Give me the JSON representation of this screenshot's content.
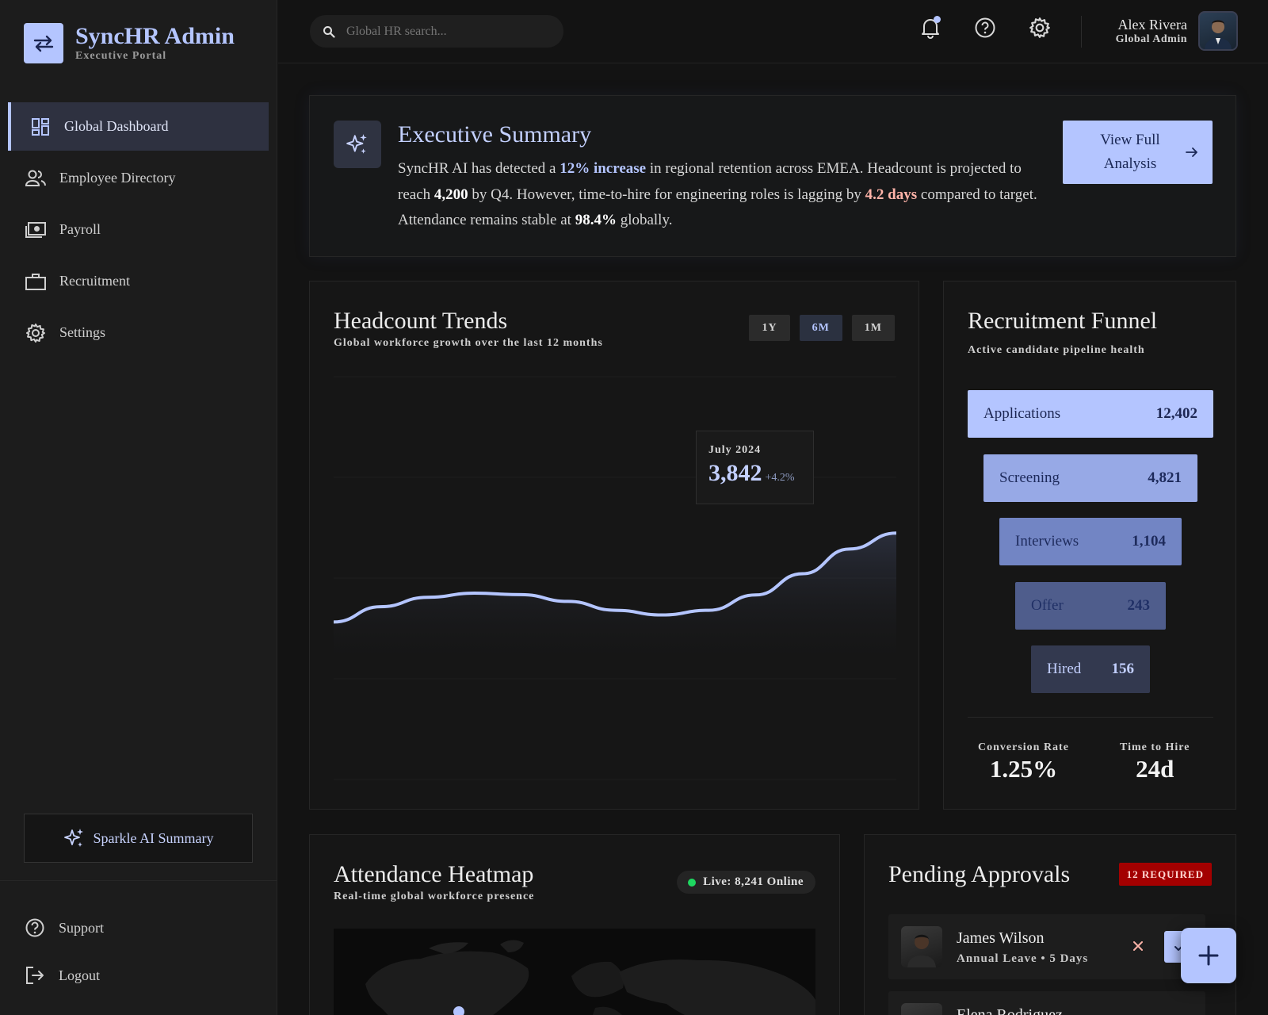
{
  "brand": {
    "title": "SyncHR Admin",
    "subtitle": "Executive Portal"
  },
  "sidebar": {
    "items": [
      {
        "label": "Global Dashboard",
        "icon": "dashboard-icon",
        "active": true
      },
      {
        "label": "Employee Directory",
        "icon": "people-icon"
      },
      {
        "label": "Payroll",
        "icon": "payroll-icon"
      },
      {
        "label": "Recruitment",
        "icon": "briefcase-icon"
      },
      {
        "label": "Settings",
        "icon": "gear-icon"
      }
    ],
    "sparkle_label": "Sparkle AI Summary",
    "support_label": "Support",
    "logout_label": "Logout"
  },
  "topbar": {
    "search_placeholder": "Global HR search...",
    "user_name": "Alex Rivera",
    "user_role": "Global Admin"
  },
  "exec_summary": {
    "title": "Executive Summary",
    "body": [
      {
        "text": "SyncHR AI has detected a ",
        "style": "plain"
      },
      {
        "text": "12% increase",
        "style": "blue"
      },
      {
        "text": " in regional retention across EMEA. Headcount is projected to reach ",
        "style": "plain"
      },
      {
        "text": "4,200",
        "style": "white"
      },
      {
        "text": " by Q4. However, time-to-hire for engineering roles is lagging by ",
        "style": "plain"
      },
      {
        "text": "4.2 days",
        "style": "red"
      },
      {
        "text": " compared to target. Attendance remains stable at ",
        "style": "plain"
      },
      {
        "text": "98.4%",
        "style": "white"
      },
      {
        "text": " globally.",
        "style": "plain"
      }
    ],
    "button_label": "View Full Analysis"
  },
  "headcount": {
    "title": "Headcount Trends",
    "subtitle": "Global workforce growth over the last 12 months",
    "ranges": [
      "1Y",
      "6M",
      "1M"
    ],
    "active_range": "6M",
    "tooltip": {
      "month": "July 2024",
      "value": "3,842",
      "change": "+4.2%"
    }
  },
  "chart_data": {
    "type": "area",
    "x": [
      0,
      1,
      2,
      3,
      4,
      5,
      6,
      7,
      8,
      9,
      10,
      11,
      12
    ],
    "values": [
      3540,
      3592,
      3624,
      3638,
      3633,
      3610,
      3580,
      3564,
      3580,
      3632,
      3704,
      3788,
      3842
    ],
    "title": "Headcount Trends",
    "xlabel": "",
    "ylabel": "",
    "ylim": [
      3000,
      4400
    ],
    "grid": true,
    "legend": "none",
    "color": "#b4c5ff"
  },
  "funnel": {
    "title": "Recruitment Funnel",
    "subtitle": "Active candidate pipeline health",
    "stages": [
      {
        "label": "Applications",
        "value": "12,402",
        "bg": "#b4c5ff",
        "fg": "#1c2652"
      },
      {
        "label": "Screening",
        "value": "4,821",
        "bg": "#97a9e6",
        "fg": "#1d2a5b"
      },
      {
        "label": "Interviews",
        "value": "1,104",
        "bg": "#7285c4",
        "fg": "#1e2b5c"
      },
      {
        "label": "Offer",
        "value": "243",
        "bg": "#4f5d8c",
        "fg": "#203066"
      },
      {
        "label": "Hired",
        "value": "156",
        "bg": "#33394f",
        "fg": "#c3d0ff"
      }
    ],
    "stats": [
      {
        "label": "Conversion Rate",
        "value": "1.25%"
      },
      {
        "label": "Time to Hire",
        "value": "24d"
      }
    ]
  },
  "attendance": {
    "title": "Attendance Heatmap",
    "subtitle": "Real-time global workforce presence",
    "live_label": "Live: 8,241 Online"
  },
  "approvals": {
    "title": "Pending Approvals",
    "badge": "12 REQUIRED",
    "items": [
      {
        "name": "James Wilson",
        "type": "Annual Leave • 5 Days"
      },
      {
        "name": "Elena Rodriguez",
        "type": ""
      }
    ]
  },
  "colors": {
    "accent": "#b4c5ff",
    "danger": "#ffb4a9",
    "live": "#1ed760",
    "badge": "#a30000"
  }
}
